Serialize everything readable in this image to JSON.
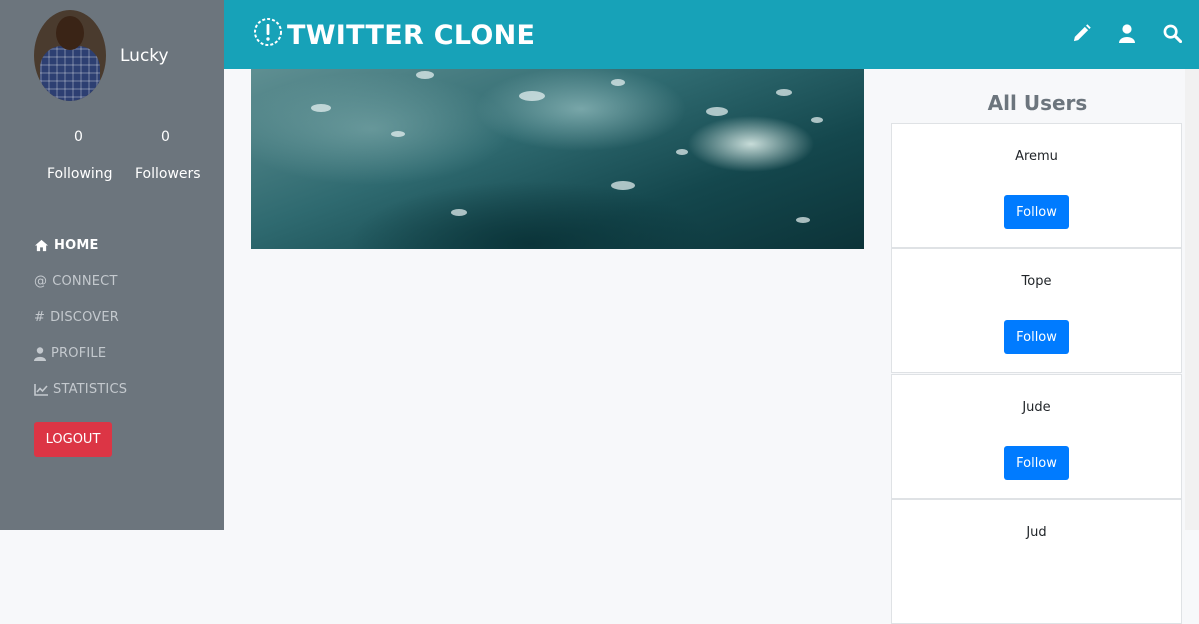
{
  "sidebar": {
    "username": "Lucky",
    "stats": [
      {
        "count": "0",
        "label": "Following"
      },
      {
        "count": "0",
        "label": "Followers"
      }
    ],
    "nav": [
      {
        "label": "HOME",
        "icon": "home-icon",
        "active": true
      },
      {
        "label": "CONNECT",
        "icon": "at-icon",
        "active": false
      },
      {
        "label": "DISCOVER",
        "icon": "hash-icon",
        "active": false
      },
      {
        "label": "PROFILE",
        "icon": "user-icon",
        "active": false
      },
      {
        "label": "STATISTICS",
        "icon": "chart-icon",
        "active": false
      }
    ],
    "logout_label": "LOGOUT"
  },
  "header": {
    "title": "TWITTER CLONE",
    "logo_icon": "exclamation-circle-icon",
    "actions": [
      "pencil-icon",
      "user-icon",
      "search-icon"
    ]
  },
  "users_panel": {
    "title": "All Users",
    "follow_label": "Follow",
    "users": [
      "Aremu",
      "Tope",
      "Jude",
      "Jud"
    ]
  },
  "colors": {
    "header": "#17a2b8",
    "sidebar": "#6c757d",
    "logout": "#dc3545",
    "follow": "#007bff",
    "background": "#f7f8fa"
  }
}
